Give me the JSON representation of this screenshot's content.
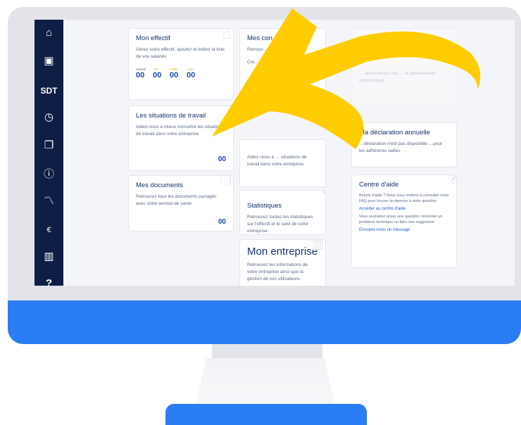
{
  "sidebar": {
    "items": [
      {
        "icon": "home-icon",
        "glyph": "⌂"
      },
      {
        "icon": "contact-card-icon",
        "glyph": "▣"
      },
      {
        "icon": "sdt-logo",
        "glyph": "SDT"
      },
      {
        "icon": "clock-icon",
        "glyph": "◷"
      },
      {
        "icon": "documents-icon",
        "glyph": "❐"
      },
      {
        "icon": "info-icon",
        "glyph": "ⓘ"
      },
      {
        "icon": "statistics-icon",
        "glyph": "〽"
      },
      {
        "icon": "euro-folder-icon",
        "glyph": "€"
      },
      {
        "icon": "building-icon",
        "glyph": "▥"
      },
      {
        "icon": "help-icon",
        "glyph": "?"
      }
    ]
  },
  "cards": {
    "effectif": {
      "title": "Mon effectif",
      "desc": "Gérez votre effectif, ajoutez et éditez la liste de vos salariés",
      "counters": [
        {
          "label": "Salarié",
          "value": "00"
        },
        {
          "label": "• SI",
          "value": "00"
        },
        {
          "label": "• SIR",
          "value": "00"
        },
        {
          "label": "• SIA",
          "value": "00"
        }
      ]
    },
    "convocations": {
      "title": "Mes con… visites",
      "desc": "Retrouv… les con…",
      "extra": "Cré…"
    },
    "faded": {
      "title": "… …ation",
      "desc": "… automatisez vos … ni prélèvement automatique"
    },
    "situations": {
      "title": "Les situations de travail",
      "desc": "Aidez-nous à mieux connaître les situations de travail dans votre entreprise",
      "count": "00"
    },
    "situations2": {
      "desc": "Aidez-nous à … situations de travail dans votre entreprise"
    },
    "declaration": {
      "title": "Ma déclaration annuelle",
      "desc": "…déclaration n'est pas disponible …pour les adhérents radiés"
    },
    "documents": {
      "title": "Mes documents",
      "desc": "Retrouvez tous les documents partagés avec votre service de santé",
      "count": "00"
    },
    "statistiques": {
      "title": "Statistiques",
      "desc": "Retrouvez toutes les statistiques sur l'effectif et le suivi de votre entreprise"
    },
    "aide": {
      "title": "Centre d'aide",
      "desc1": "Besoin d'aide ? Nous vous invitons à consulter notre FAQ pour trouver la réponse à votre question",
      "link1": "Accéder au centre d'aide",
      "desc2": "Vous souhaitez poser une question, remonter un problème technique ou faire une suggestion",
      "link2": "Envoyez-nous un message"
    },
    "entreprise": {
      "title": "Mon entreprise",
      "desc": "Retrouvez les informations de votre entreprise ainsi que la gestion de vos utilisateurs"
    }
  },
  "colors": {
    "sidebar": "#0f1e44",
    "accent": "#2a7df2",
    "arrow": "#ffcc00",
    "title": "#14306a"
  }
}
